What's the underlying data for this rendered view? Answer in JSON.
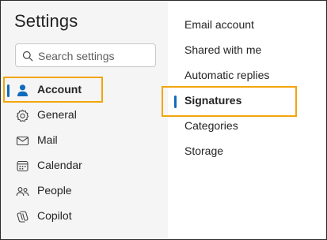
{
  "settings": {
    "title": "Settings",
    "search": {
      "placeholder": "Search settings",
      "icon": "search-icon"
    }
  },
  "left_nav": {
    "items": [
      {
        "label": "Account",
        "icon": "person-icon",
        "selected": true
      },
      {
        "label": "General",
        "icon": "gear-icon"
      },
      {
        "label": "Mail",
        "icon": "mail-icon"
      },
      {
        "label": "Calendar",
        "icon": "calendar-icon"
      },
      {
        "label": "People",
        "icon": "people-icon"
      },
      {
        "label": "Copilot",
        "icon": "copilot-icon"
      }
    ]
  },
  "account_menu": {
    "items": [
      {
        "label": "Email account"
      },
      {
        "label": "Shared with me"
      },
      {
        "label": "Automatic replies"
      },
      {
        "label": "Signatures",
        "selected": true
      },
      {
        "label": "Categories"
      },
      {
        "label": "Storage"
      }
    ]
  },
  "colors": {
    "accent": "#0f6cbd",
    "highlight": "#f2a50c",
    "pane_background": "#f5f5f5"
  }
}
